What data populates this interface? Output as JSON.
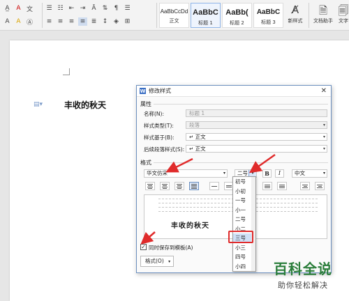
{
  "ribbon": {
    "styles": [
      {
        "sample": "AaBbCcDd",
        "name": "正文"
      },
      {
        "sample": "AaBbC",
        "name": "标题 1"
      },
      {
        "sample": "AaBb(",
        "name": "标题 2"
      },
      {
        "sample": "AaBbC",
        "name": "标题 3"
      }
    ],
    "new_style_label": "新样式",
    "doc_assistant_label": "文档助手",
    "more_label": "文字"
  },
  "document": {
    "heading_text": "丰收的秋天"
  },
  "dialog": {
    "title": "修改样式",
    "properties_section": "属性",
    "name_label": "名称(N):",
    "name_value": "标题 1",
    "style_type_label": "样式类型(T):",
    "style_type_value": "段落",
    "based_on_label": "样式基于(B):",
    "based_on_value": "↵ 正文",
    "next_style_label": "后续段落样式(S):",
    "next_style_value": "↵ 正文",
    "format_section": "格式",
    "font_value": "华文仿宋",
    "size_value": "二号",
    "bold_label": "B",
    "italic_label": "I",
    "lang_value": "中文",
    "preview_text": "丰收的秋天",
    "save_template_label": "同时保存到模板(A)",
    "format_button_label": "格式(O)",
    "size_options": [
      "初号",
      "小初",
      "一号",
      "小一",
      "二号",
      "小二",
      "三号",
      "小三",
      "四号",
      "小四"
    ],
    "selected_size": "三号"
  },
  "watermark": {
    "title": "百科全说",
    "subtitle": "助你轻松解决"
  },
  "colors": {
    "accent": "#3b6fc4",
    "annotation_red": "#e02b2b",
    "watermark_green": "#2a7d3a"
  }
}
